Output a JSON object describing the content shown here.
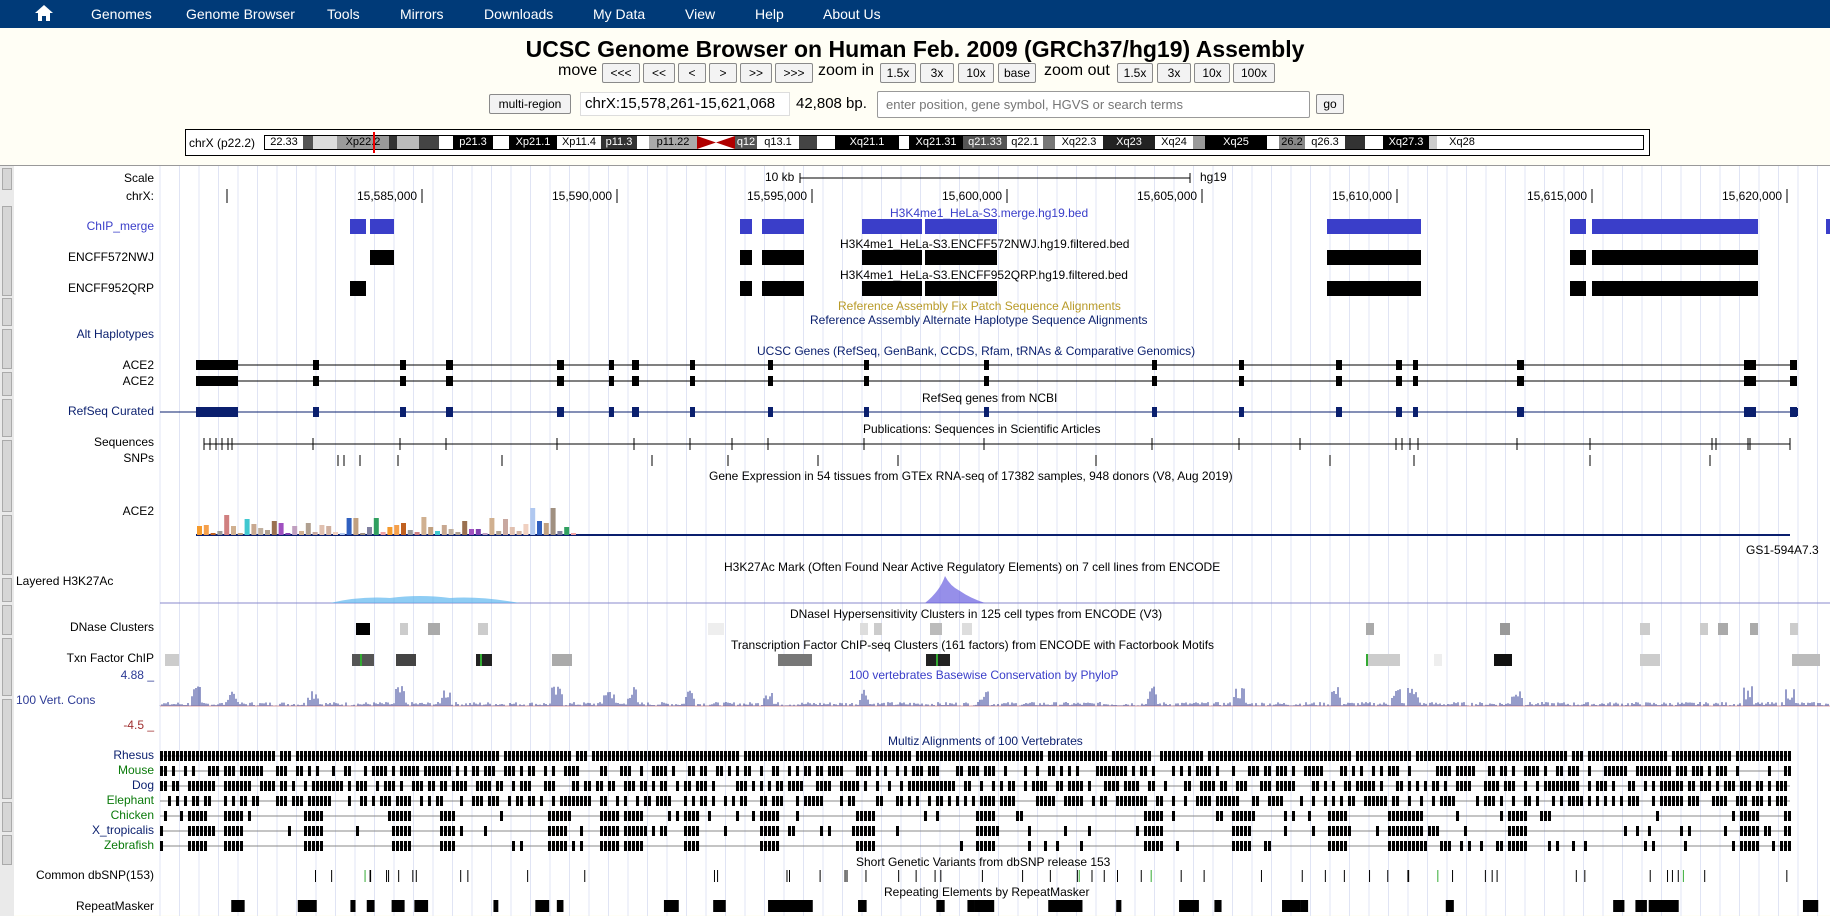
{
  "nav": {
    "items": [
      "Genomes",
      "Genome Browser",
      "Tools",
      "Mirrors",
      "Downloads",
      "My Data",
      "View",
      "Help",
      "About Us"
    ]
  },
  "title": "UCSC Genome Browser on Human Feb. 2009 (GRCh37/hg19) Assembly",
  "controls": {
    "move_label": "move",
    "move_buttons": [
      "<<<",
      "<<",
      "<",
      ">",
      ">>",
      ">>>"
    ],
    "zoom_in_label": "zoom in",
    "zoom_in_buttons": [
      "1.5x",
      "3x",
      "10x",
      "base"
    ],
    "zoom_out_label": "zoom out",
    "zoom_out_buttons": [
      "1.5x",
      "3x",
      "10x",
      "100x"
    ],
    "multi_region": "multi-region",
    "position": "chrX:15,578,261-15,621,068",
    "size": "42,808 bp.",
    "search_placeholder": "enter position, gene symbol, HGVS or search terms",
    "go": "go"
  },
  "ideogram": {
    "chrom_label": "chrX (p22.2)",
    "bands": [
      "22.33",
      "Xp22.2",
      "p21.3",
      "Xp21.1",
      "Xp11.4",
      "p11.3",
      "p11.22",
      "q12",
      "q13.1",
      "Xq21.1",
      "Xq21.31",
      "q21.33",
      "q22.1",
      "Xq22.3",
      "Xq23",
      "Xq24",
      "Xq25",
      "26.2",
      "q26.3",
      "Xq27.3",
      "Xq28"
    ]
  },
  "ruler": {
    "scale_label": "Scale",
    "chr_label": "chrX:",
    "scale_text": "10 kb",
    "assembly": "hg19",
    "ticks": [
      "15,585,000",
      "15,590,000",
      "15,595,000",
      "15,600,000",
      "15,605,000",
      "15,610,000",
      "15,615,000",
      "15,620,000"
    ]
  },
  "track_labels": {
    "chip_merge": "ChIP_merge",
    "encff572": "ENCFF572NWJ",
    "encff952": "ENCFF952QRP",
    "alt_hap": "Alt Haplotypes",
    "ace2_a": "ACE2",
    "ace2_b": "ACE2",
    "refseq": "RefSeq Curated",
    "sequences": "Sequences",
    "snps": "SNPs",
    "gtex": "ACE2",
    "h3k27ac": "Layered H3K27Ac",
    "dnase": "DNase Clusters",
    "txn": "Txn Factor ChIP",
    "cons": "100 Vert. Cons",
    "cons_max": "4.88 _",
    "cons_min": "-4.5 _",
    "rhesus": "Rhesus",
    "mouse": "Mouse",
    "dog": "Dog",
    "elephant": "Elephant",
    "chicken": "Chicken",
    "xtrop": "X_tropicalis",
    "zebrafish": "Zebrafish",
    "dbsnp": "Common dbSNP(153)",
    "repeat": "RepeatMasker"
  },
  "track_titles": {
    "chip_merge": "H3K4me1_HeLa-S3.merge.hg19.bed",
    "encff572": "H3K4me1_HeLa-S3.ENCFF572NWJ.hg19.filtered.bed",
    "encff952": "H3K4me1_HeLa-S3.ENCFF952QRP.hg19.filtered.bed",
    "fix_patch": "Reference Assembly Fix Patch Sequence Alignments",
    "alt_hap": "Reference Assembly Alternate Haplotype Sequence Alignments",
    "ucsc_genes": "UCSC Genes (RefSeq, GenBank, CCDS, Rfam, tRNAs & Comparative Genomics)",
    "refseq": "RefSeq genes from NCBI",
    "publications": "Publications: Sequences in Scientific Articles",
    "gtex": "Gene Expression in 54 tissues from GTEx RNA-seq of 17382 samples, 948 donors (V8, Aug 2019)",
    "gs1": "GS1-594A7.3",
    "h3k27ac": "H3K27Ac Mark (Often Found Near Active Regulatory Elements) on 7 cell lines from ENCODE",
    "dnase": "DNaseI Hypersensitivity Clusters in 125 cell types from ENCODE (V3)",
    "txn": "Transcription Factor ChIP-seq Clusters (161 factors) from ENCODE with Factorbook Motifs",
    "cons": "100 vertebrates Basewise Conservation by PhyloP",
    "multiz": "Multiz Alignments of 100 Vertebrates",
    "dbsnp": "Short Genetic Variants from dbSNP release 153",
    "repeat": "Repeating Elements by RepeatMasker"
  },
  "colors": {
    "navbar": "#003a78",
    "chip_blue": "#3a3ec9",
    "gene_navy": "#0a1f6e",
    "title_blue": "#3a3ec9",
    "fix_patch_gold": "#b89a28",
    "species_green": "#0a7a0a",
    "species_navy": "#0a1f6e",
    "cons_blue": "#2c3a95"
  }
}
